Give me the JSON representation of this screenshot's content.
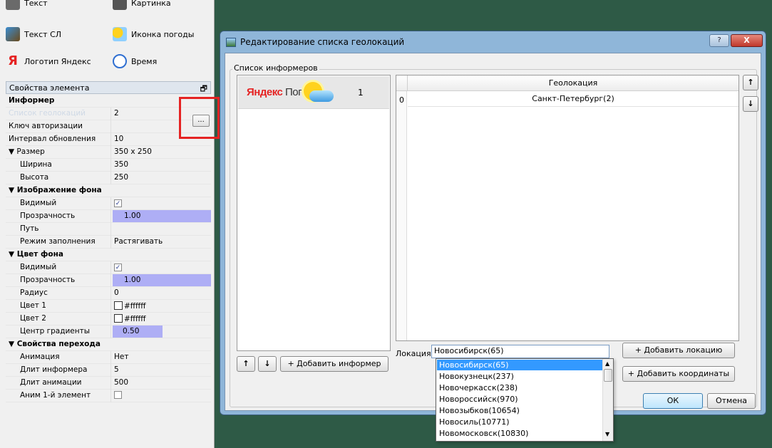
{
  "toolbox": {
    "items": [
      {
        "label": "Текст",
        "icon": "text-icon"
      },
      {
        "label": "Картинка",
        "icon": "image-icon"
      },
      {
        "label": "Текст СЛ",
        "icon": "text-sl-icon"
      },
      {
        "label": "Иконка погоды",
        "icon": "weather-icon"
      },
      {
        "label": "Логотип Яндекс",
        "icon": "yandex-logo-icon"
      },
      {
        "label": "Время",
        "icon": "clock-icon"
      }
    ],
    "yandex_letter": "Я"
  },
  "props": {
    "title": "Свойства элемента",
    "group": "Информер",
    "rows": [
      {
        "k": "Список геолокаций",
        "v": "2"
      },
      {
        "k": "Ключ авторизации",
        "v": ""
      },
      {
        "k": "Интервал обновления",
        "v": "10"
      },
      {
        "k": "▼ Размер",
        "v": "350 x 250"
      },
      {
        "k": "Ширина",
        "v": "350"
      },
      {
        "k": "Высота",
        "v": "250"
      },
      {
        "k": "▼ Изображение фона",
        "v": ""
      },
      {
        "k": "Видимый",
        "v": "✓"
      },
      {
        "k": "Прозрачность",
        "v": "1.00"
      },
      {
        "k": "Путь",
        "v": ""
      },
      {
        "k": "Режим заполнения",
        "v": "Растягивать"
      },
      {
        "k": "▼ Цвет фона",
        "v": ""
      },
      {
        "k": "Видимый",
        "v": "✓"
      },
      {
        "k": "Прозрачность",
        "v": "1.00"
      },
      {
        "k": "Радиус",
        "v": "0"
      },
      {
        "k": "Цвет 1",
        "v": "#ffffff"
      },
      {
        "k": "Цвет 2",
        "v": "#ffffff"
      },
      {
        "k": "Центр градиенты",
        "v": "0.50"
      },
      {
        "k": "▼ Свойства перехода",
        "v": ""
      },
      {
        "k": "Анимация",
        "v": "Нет"
      },
      {
        "k": "Длит информера",
        "v": "5"
      },
      {
        "k": "Длит анимации",
        "v": "500"
      },
      {
        "k": "Аним 1-й элемент",
        "v": ""
      }
    ],
    "dots": "..."
  },
  "dialog": {
    "title": "Редактирование списка геолокаций",
    "help": "?",
    "close": "X",
    "group_label": "Список информеров",
    "informer": {
      "logo_main": "Яндекс",
      "logo_sub": " Погода",
      "number": "1"
    },
    "buttons": {
      "up": "↑",
      "down": "↓",
      "add_informer": "+ Добавить информер",
      "add_location": "+ Добавить локацию",
      "add_coords": "+ Добавить координаты",
      "ok": "ОК",
      "cancel": "Отмена",
      "row_up": "↑",
      "row_down": "↓"
    },
    "table": {
      "header": "Геолокация",
      "rows": [
        {
          "idx": "0",
          "value": "Санкт-Петербург(2)"
        }
      ]
    },
    "location_label": "Локация",
    "location_value": "Новосибирск(65)",
    "suggestions": [
      "Новосибирск(65)",
      "Новокузнецк(237)",
      "Новочеркасск(238)",
      "Новороссийск(970)",
      "Новозыбков(10654)",
      "Новосиль(10771)",
      "Новомосковск(10830)"
    ]
  },
  "colors": {
    "desktop": "#2e5a46",
    "highlight": "#3399ff",
    "annotation": "#e52323"
  }
}
